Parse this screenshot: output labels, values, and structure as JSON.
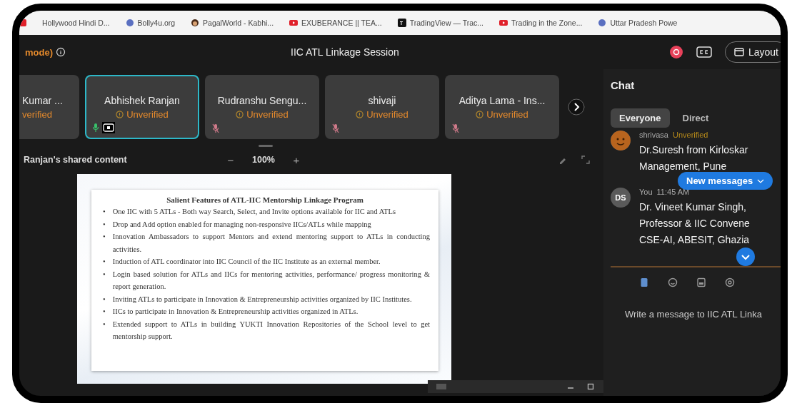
{
  "bookmarks": [
    {
      "label": "Hollywood Hindi D...",
      "kind": "plain"
    },
    {
      "label": "Bolly4u.org",
      "kind": "globe"
    },
    {
      "label": "PagalWorld - Kabhi...",
      "kind": "face"
    },
    {
      "label": "EXUBERANCE || TEA...",
      "kind": "video"
    },
    {
      "label": "TradingView — Trac...",
      "kind": "tv"
    },
    {
      "label": "Trading in the Zone...",
      "kind": "video"
    },
    {
      "label": "Uttar Pradesh Powe",
      "kind": "globe"
    }
  ],
  "header": {
    "mode_label": "mode)",
    "title": "IIC ATL Linkage Session",
    "recording": true,
    "layout_button": "Layout"
  },
  "participants": [
    {
      "name": "Kumar ...",
      "status": "verified",
      "selected": false,
      "muted": false,
      "sharing": false,
      "clipped": true
    },
    {
      "name": "Abhishek Ranjan",
      "status": "Unverified",
      "selected": true,
      "muted": false,
      "sharing": true,
      "clipped": false
    },
    {
      "name": "Rudranshu Sengu...",
      "status": "Unverified",
      "selected": false,
      "muted": true,
      "sharing": false,
      "clipped": false
    },
    {
      "name": "shivaji",
      "status": "Unverified",
      "selected": false,
      "muted": true,
      "sharing": false,
      "clipped": false
    },
    {
      "name": "Aditya Lama - Ins...",
      "status": "Unverified",
      "selected": false,
      "muted": true,
      "sharing": false,
      "clipped": false
    }
  ],
  "share_bar": {
    "label": "Ranjan's shared content",
    "zoom_out": "−",
    "zoom": "100%",
    "zoom_in": "+"
  },
  "slide": {
    "title": "Salient Features of ATL-IIC Mentorship Linkage Program",
    "marker": "•",
    "bullets": [
      "One IIC with 5 ATLs - Both way Search, Select, and Invite options available for IIC and ATLs",
      "Drop and Add option enabled for managing non-responsive IICs/ATLs while mapping",
      "Innovation Ambassadors to support Mentors and extend mentoring support to ATLs in conducting activities.",
      "Induction of ATL coordinator into IIC Council of the IIC Institute as an external member.",
      "Login based solution for ATLs and IICs for mentoring activities, performance/ progress monitoring & report generation.",
      "Inviting ATLs to participate in Innovation & Entrepreneurship activities organized by IIC Institutes.",
      "IICs to participate in Innovation & Entrepreneurship activities organized in ATLs.",
      "Extended support to ATLs in building YUKTI Innovation Repositories of the School level to get mentorship support."
    ]
  },
  "chat": {
    "title": "Chat",
    "tabs": [
      {
        "label": "Everyone",
        "selected": true
      },
      {
        "label": "Direct",
        "selected": false
      }
    ],
    "messages": [
      {
        "sender": "shrivasa",
        "status": "Unverified",
        "lines": [
          "Dr.Suresh from Kirloskar",
          "Management, Pune"
        ]
      },
      {
        "avatar": "DS",
        "sender": "You",
        "time": "11:45 AM",
        "lines": [
          "Dr. Vineet Kumar Singh,",
          "Professor & IIC Convene",
          "CSE-AI, ABESIT, Ghazia"
        ]
      }
    ],
    "new_messages": "New messages",
    "placeholder": "Write a message to IIC ATL Linka"
  }
}
